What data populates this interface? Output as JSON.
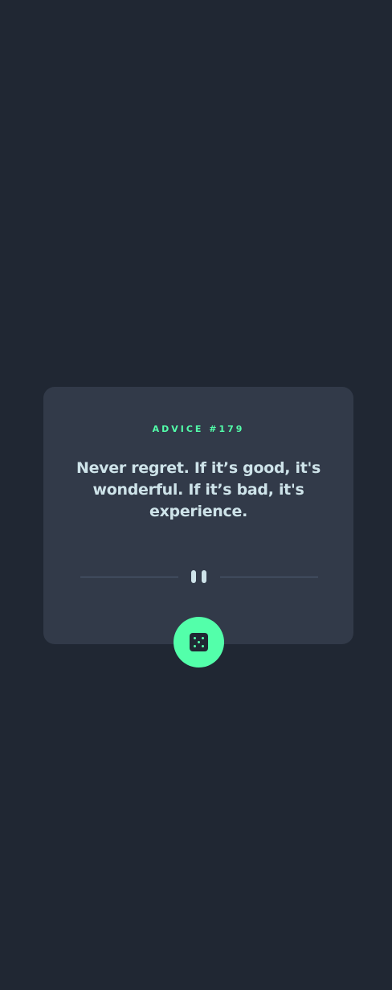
{
  "advice": {
    "id_label": "ADVICE #179",
    "quote": "Never regret. If it’s good, it's wonderful. If it’s bad, it's experience."
  },
  "dice_button": {
    "icon": "dice-icon"
  },
  "colors": {
    "background": "#202733",
    "card": "#323a49",
    "accent": "#53ffaa",
    "text": "#cee3e9",
    "divider": "#4f5d74"
  }
}
